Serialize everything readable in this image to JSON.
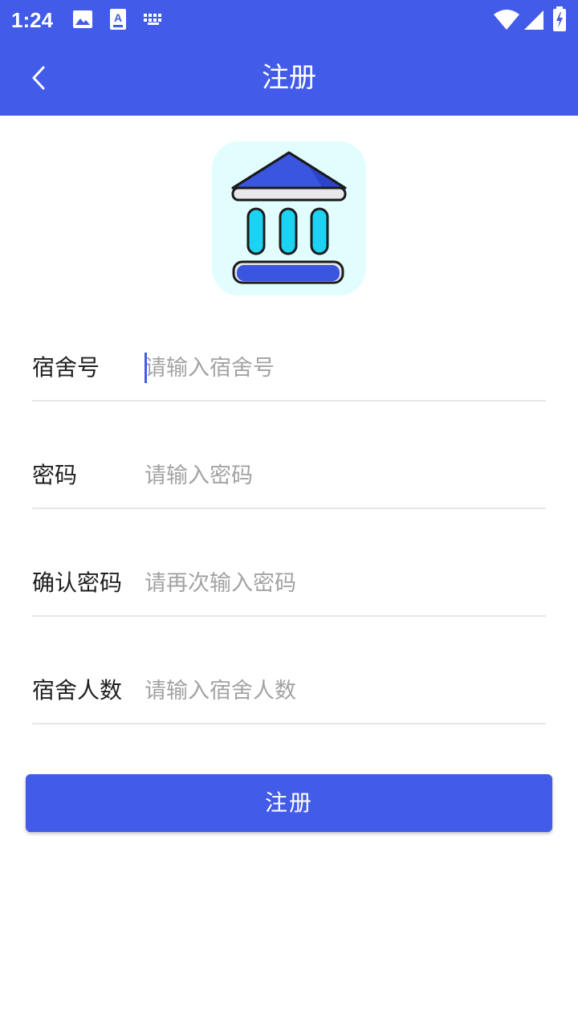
{
  "status_bar": {
    "time": "1:24",
    "icons": [
      "image-icon",
      "font-icon",
      "keyboard-icon",
      "wifi-icon",
      "signal-icon",
      "battery-charging-icon"
    ]
  },
  "app_bar": {
    "title": "注册",
    "back_icon": "chevron-left-icon"
  },
  "logo": {
    "icon": "building-icon"
  },
  "form": {
    "fields": [
      {
        "label": "宿舍号",
        "placeholder": "请输入宿舍号",
        "value": ""
      },
      {
        "label": "密码",
        "placeholder": "请输入密码",
        "value": ""
      },
      {
        "label": "确认密码",
        "placeholder": "请再次输入密码",
        "value": ""
      },
      {
        "label": "宿舍人数",
        "placeholder": "请输入宿舍人数",
        "value": ""
      }
    ]
  },
  "register_button": {
    "label": "注册"
  },
  "colors": {
    "primary": "#425BE8",
    "logo_background": "#E2FDFD",
    "pillar": "#1CD3F4",
    "placeholder": "#A3A3A3",
    "divider": "#E6E6E6"
  }
}
